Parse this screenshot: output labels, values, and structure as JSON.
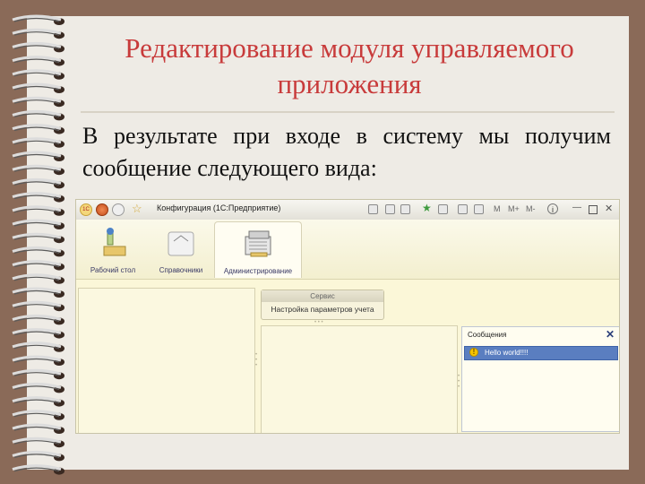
{
  "slide": {
    "title": "Редактирование модуля управляемого приложения",
    "text": "В результате при входе в систему мы получим сообщение следующего вида:"
  },
  "window": {
    "title": "Конфигурация  (1С:Предприятие)",
    "toolbar_labels": [
      "M",
      "M+",
      "M-"
    ],
    "sections": [
      {
        "label": "Рабочий стол",
        "icon": "desktop-icon"
      },
      {
        "label": "Справочники",
        "icon": "catalogs-icon"
      },
      {
        "label": "Администрирование",
        "icon": "administration-icon",
        "active": true
      }
    ],
    "service_panel": {
      "header": "Сервис",
      "item": "Настройка параметров учета"
    },
    "messages": {
      "title": "Сообщения",
      "items": [
        "Hello world!!!!"
      ]
    }
  },
  "colors": {
    "title": "#c83b3b",
    "paper": "#eeebe5",
    "background": "#8a6a58",
    "message_highlight": "#5a7ec0"
  }
}
